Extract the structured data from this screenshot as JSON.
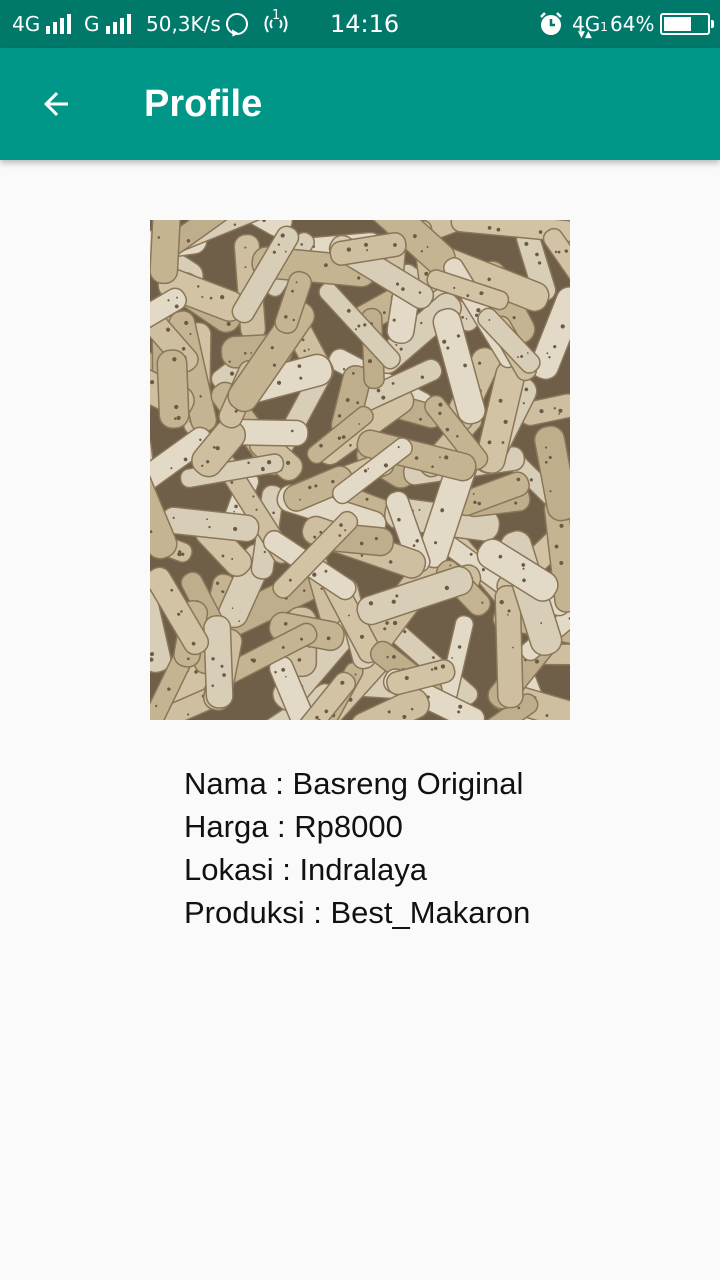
{
  "status_bar": {
    "network_1": "4G",
    "network_2": "G",
    "speed": "50,3K/s",
    "hotspot_badge": "1",
    "time": "14:16",
    "network_right": "4G",
    "network_right_sub": "1",
    "battery_percent_text": "64%",
    "battery_level": 0.64
  },
  "app_bar": {
    "title": "Profile",
    "back_icon": "arrow-back-icon",
    "color": "#009688"
  },
  "product": {
    "image_alt": "basreng-chips-photo",
    "rows": [
      {
        "text": "Nama : Basreng Original"
      },
      {
        "text": "Harga : Rp8000"
      },
      {
        "text": "Lokasi : Indralaya"
      },
      {
        "text": "Produksi : Best_Makaron"
      }
    ]
  }
}
